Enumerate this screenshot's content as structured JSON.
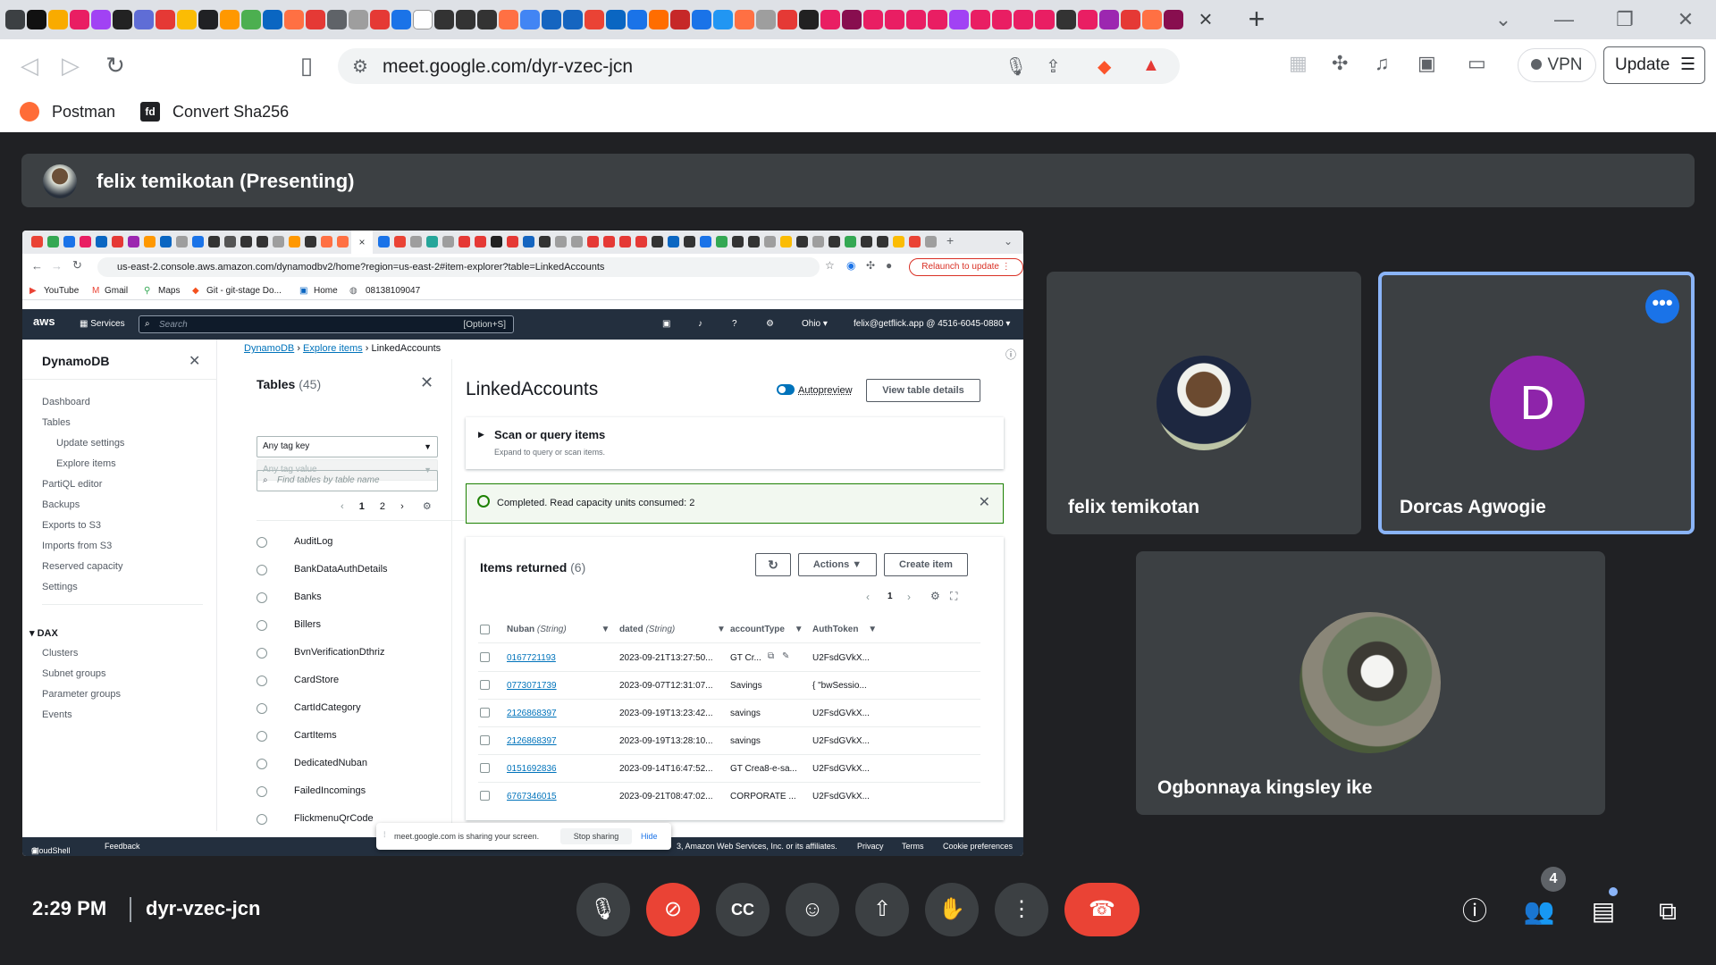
{
  "browser": {
    "url": "meet.google.com/dyr-vzec-jcn",
    "vpn_label": "VPN",
    "update_label": "Update",
    "bookmarks": [
      "Postman",
      "Convert Sha256"
    ],
    "fd_badge": "fd"
  },
  "meet": {
    "presenting_title": "felix temikotan (Presenting)",
    "time": "2:29 PM",
    "meeting_code": "dyr-vzec-jcn",
    "participant_count": "4",
    "participants": [
      {
        "name": "felix temikotan"
      },
      {
        "name": "Dorcas Agwogie",
        "initial": "D"
      },
      {
        "name": "Ogbonnaya kingsley ike"
      }
    ]
  },
  "shared": {
    "url": "us-east-2.console.aws.amazon.com/dynamodbv2/home?region=us-east-2#item-explorer?table=LinkedAccounts",
    "relaunch": "Relaunch to update",
    "bookmarks": [
      "YouTube",
      "Gmail",
      "Maps",
      "Git - git-stage Do...",
      "Home",
      "08138109047"
    ],
    "aws": {
      "logo": "aws",
      "services": "Services",
      "search_placeholder": "Search",
      "search_hotkey": "[Option+S]",
      "region": "Ohio ▾",
      "account": "felix@getflick.app @ 4516-6045-0880 ▾"
    },
    "sidebar": {
      "title": "DynamoDB",
      "items": [
        "Dashboard",
        "Tables",
        "Update settings",
        "Explore items",
        "PartiQL editor",
        "Backups",
        "Exports to S3",
        "Imports from S3",
        "Reserved capacity",
        "Settings"
      ],
      "dax_title": "DAX",
      "dax_items": [
        "Clusters",
        "Subnet groups",
        "Parameter groups",
        "Events"
      ]
    },
    "breadcrumbs": [
      "DynamoDB",
      "Explore items",
      "LinkedAccounts"
    ],
    "tables_panel": {
      "title": "Tables",
      "count": "(45)",
      "tag_key": "Any tag key",
      "tag_value": "Any tag value",
      "find_placeholder": "Find tables by table name",
      "page_current": "1",
      "page_next": "2",
      "tables": [
        "AuditLog",
        "BankDataAuthDetails",
        "Banks",
        "Billers",
        "BvnVerificationDthriz",
        "CardStore",
        "CartIdCategory",
        "CartItems",
        "DedicatedNuban",
        "FailedIncomings",
        "FlickmenuQrCode"
      ]
    },
    "main": {
      "title": "LinkedAccounts",
      "autopreview": "Autopreview",
      "view_details": "View table details",
      "scan_title": "Scan or query items",
      "scan_sub": "Expand to query or scan items.",
      "flash": "Completed. Read capacity units consumed: 2",
      "items_title": "Items returned",
      "items_count": "(6)",
      "actions": "Actions",
      "create": "Create item",
      "page": "1",
      "columns": [
        {
          "name": "Nuban",
          "type": "(String)"
        },
        {
          "name": "dated",
          "type": "(String)"
        },
        {
          "name": "accountType",
          "type": ""
        },
        {
          "name": "AuthToken",
          "type": ""
        }
      ],
      "rows": [
        {
          "nuban": "0167721193",
          "dated": "2023-09-21T13:27:50...",
          "type": "GT Cr...",
          "token": "U2FsdGVkX..."
        },
        {
          "nuban": "0773071739",
          "dated": "2023-09-07T12:31:07...",
          "type": "Savings",
          "token": "{ \"bwSessio..."
        },
        {
          "nuban": "2126868397",
          "dated": "2023-09-19T13:23:42...",
          "type": "savings",
          "token": "U2FsdGVkX..."
        },
        {
          "nuban": "2126868397",
          "dated": "2023-09-19T13:28:10...",
          "type": "savings",
          "token": "U2FsdGVkX..."
        },
        {
          "nuban": "0151692836",
          "dated": "2023-09-14T16:47:52...",
          "type": "GT Crea8-e-sa...",
          "token": "U2FsdGVkX..."
        },
        {
          "nuban": "6767346015",
          "dated": "2023-09-21T08:47:02...",
          "type": "CORPORATE ...",
          "token": "U2FsdGVkX..."
        }
      ]
    },
    "footer": {
      "cloudshell": "CloudShell",
      "feedback": "Feedback",
      "copyright": "3, Amazon Web Services, Inc. or its affiliates.",
      "privacy": "Privacy",
      "terms": "Terms",
      "cookies": "Cookie preferences"
    },
    "share_popup": {
      "text": "meet.google.com is sharing your screen.",
      "stop": "Stop sharing",
      "hide": "Hide"
    }
  }
}
